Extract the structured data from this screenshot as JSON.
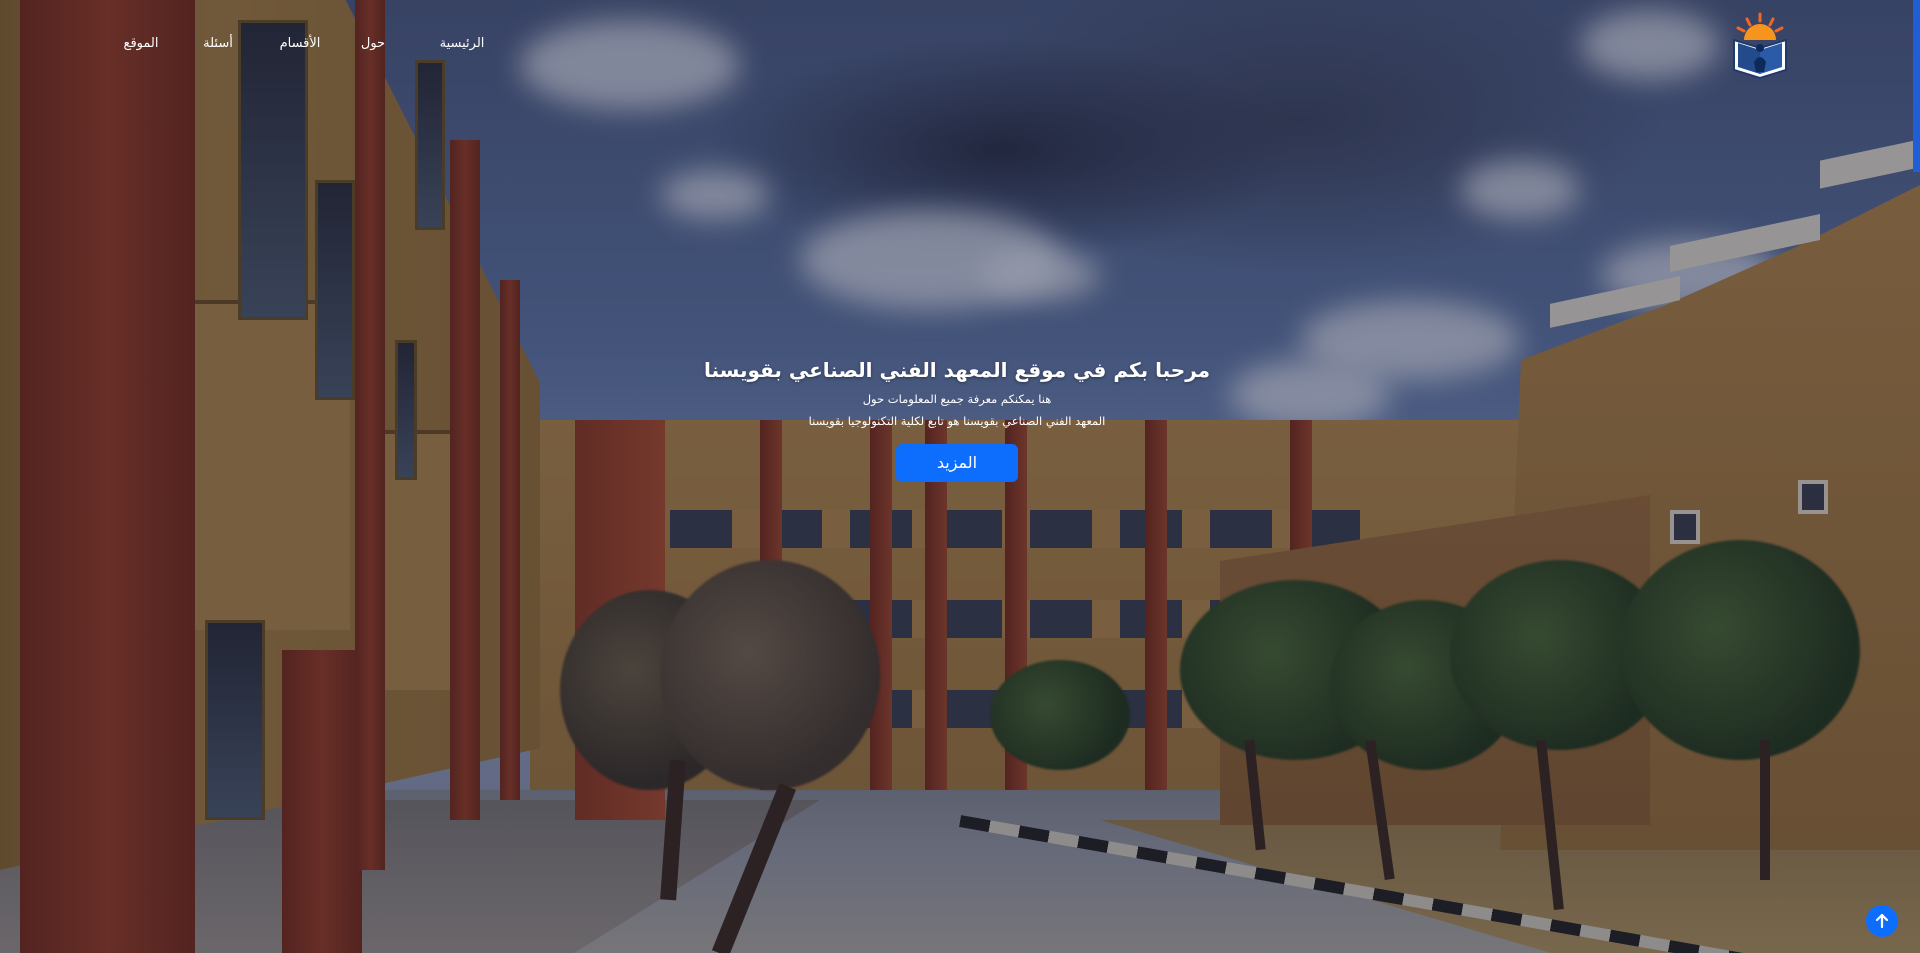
{
  "header": {
    "logo_icon": "book-sun-logo-icon",
    "nav": {
      "home": "الرئيسية",
      "about": "حول",
      "departments": "الأقسام",
      "faq": "أسئلة",
      "location": "الموقع"
    }
  },
  "hero": {
    "title": "مرحبا بكم في موقع المعهد الفني الصناعي بقويسنا",
    "subtitle_line1": "هنا يمكنكم معرفة جميع المعلومات حول",
    "subtitle_line2": "المعهد الفني الصناعي بقويسنا هو تابع لكلية التكنولوجيا بقويسنا",
    "button_label": "المزيد"
  },
  "back_to_top_icon": "arrow-up-icon",
  "colors": {
    "accent": "#0d6efd",
    "scroll_indicator": "#1f5ed6",
    "text": "#ffffff"
  }
}
